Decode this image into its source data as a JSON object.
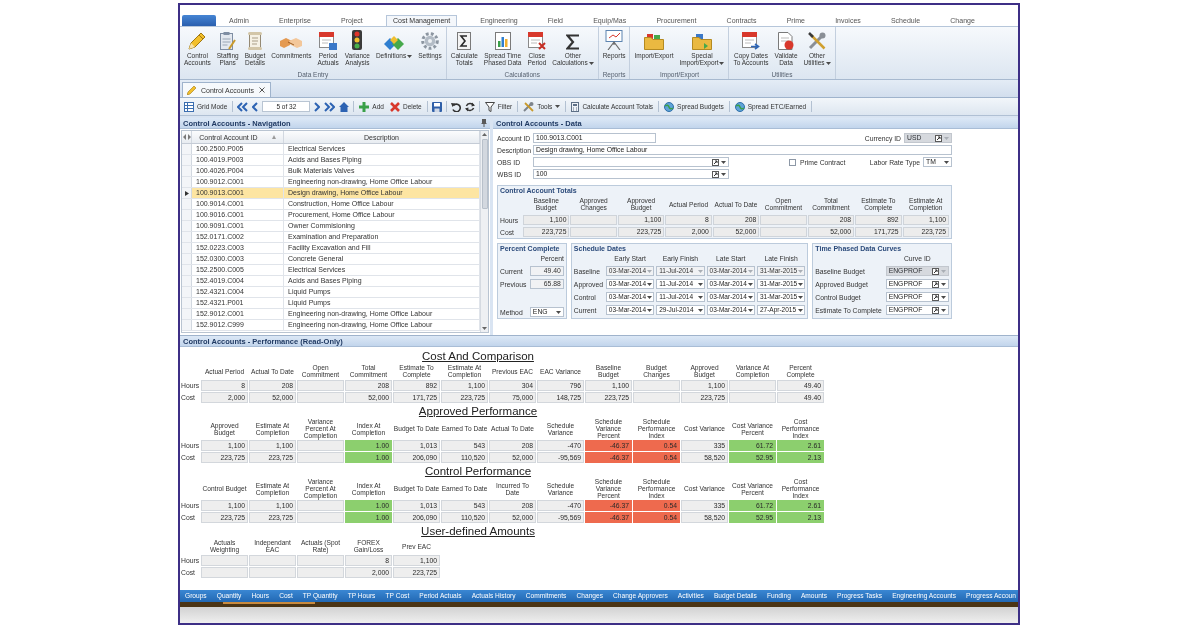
{
  "ribbon_tabs": [
    {
      "label": "Admin",
      "selected": false
    },
    {
      "label": "Enterprise",
      "selected": false
    },
    {
      "label": "Project",
      "selected": false
    },
    {
      "label": "Cost Management",
      "selected": true
    },
    {
      "label": "Engineering",
      "selected": false
    },
    {
      "label": "Field",
      "selected": false
    },
    {
      "label": "Equip/Mas",
      "selected": false
    },
    {
      "label": "Procurement",
      "selected": false
    },
    {
      "label": "Contracts",
      "selected": false
    },
    {
      "label": "Prime",
      "selected": false
    },
    {
      "label": "Invoices",
      "selected": false
    },
    {
      "label": "Schedule",
      "selected": false
    },
    {
      "label": "Change",
      "selected": false
    }
  ],
  "ribbon_groups": [
    {
      "label": "Data Entry",
      "buttons": [
        {
          "label": "Control\nAccounts",
          "dropdown": false
        },
        {
          "label": "Staffing\nPlans",
          "dropdown": false
        },
        {
          "label": "Budget\nDetails",
          "dropdown": false
        },
        {
          "label": "Commitments",
          "dropdown": false
        },
        {
          "label": "Period\nActuals",
          "dropdown": false
        },
        {
          "label": "Variance\nAnalysis",
          "dropdown": false
        },
        {
          "label": "Definitions",
          "dropdown": true
        },
        {
          "label": "Settings",
          "dropdown": false
        }
      ]
    },
    {
      "label": "Calculations",
      "buttons": [
        {
          "label": "Calculate\nTotals",
          "dropdown": false
        },
        {
          "label": "Spread Time\nPhased Data",
          "dropdown": false
        },
        {
          "label": "Close\nPeriod",
          "dropdown": false
        },
        {
          "label": "Other\nCalculations",
          "dropdown": true
        }
      ]
    },
    {
      "label": "Reports",
      "buttons": [
        {
          "label": "Reports",
          "dropdown": false
        }
      ]
    },
    {
      "label": "Import/Export",
      "buttons": [
        {
          "label": "Import/Export",
          "dropdown": false
        },
        {
          "label": "Special\nImport/Export",
          "dropdown": true
        }
      ]
    },
    {
      "label": "Utilities",
      "buttons": [
        {
          "label": "Copy Dates\nTo Accounts",
          "dropdown": false
        },
        {
          "label": "Validate\nData",
          "dropdown": false
        },
        {
          "label": "Other\nUtilities",
          "dropdown": true
        }
      ]
    }
  ],
  "document_tabs": [
    {
      "label": "Control Accounts",
      "selected": true
    }
  ],
  "toolbar": [
    {
      "kind": "button",
      "label": "Grid Mode",
      "dropdown": false
    },
    {
      "kind": "separator"
    },
    {
      "kind": "icon"
    },
    {
      "kind": "icon"
    },
    {
      "kind": "field",
      "value": "5 of 32"
    },
    {
      "kind": "icon"
    },
    {
      "kind": "icon"
    },
    {
      "kind": "icon"
    },
    {
      "kind": "separator"
    },
    {
      "kind": "button",
      "label": "Add",
      "dropdown": false
    },
    {
      "kind": "button",
      "label": "Delete",
      "dropdown": false
    },
    {
      "kind": "separator"
    },
    {
      "kind": "icon"
    },
    {
      "kind": "separator"
    },
    {
      "kind": "icon"
    },
    {
      "kind": "icon"
    },
    {
      "kind": "separator"
    },
    {
      "kind": "button",
      "label": "Filter",
      "dropdown": false
    },
    {
      "kind": "separator"
    },
    {
      "kind": "button",
      "label": "Tools",
      "dropdown": true
    },
    {
      "kind": "separator"
    },
    {
      "kind": "button",
      "label": "Calculate Account Totals",
      "dropdown": false
    },
    {
      "kind": "separator"
    },
    {
      "kind": "button",
      "label": "Spread Budgets",
      "dropdown": false
    },
    {
      "kind": "separator"
    },
    {
      "kind": "button",
      "label": "Spread ETC/Earned",
      "dropdown": false
    },
    {
      "kind": "separator"
    }
  ],
  "navigation": {
    "title": "Control Accounts - Navigation",
    "columns": [
      {
        "label": "Control Account ID",
        "sorted": true
      },
      {
        "label": "Description",
        "sorted": false
      }
    ],
    "rows": [
      {
        "id": "100.2500.P005",
        "description": "Electrical Services",
        "selected": false
      },
      {
        "id": "100.4019.P003",
        "description": "Acids and Bases Piping",
        "selected": false
      },
      {
        "id": "100.4026.P004",
        "description": "Bulk Materials Valves",
        "selected": false
      },
      {
        "id": "100.9012.C001",
        "description": "Engineering non-drawing, Home Office Labour",
        "selected": false
      },
      {
        "id": "100.9013.C001",
        "description": "Design drawing, Home Office Labour",
        "selected": true
      },
      {
        "id": "100.9014.C001",
        "description": "Construction, Home Office Labour",
        "selected": false
      },
      {
        "id": "100.9016.C001",
        "description": "Procurement, Home Office Labour",
        "selected": false
      },
      {
        "id": "100.9091.C001",
        "description": "Owner Commisioning",
        "selected": false
      },
      {
        "id": "152.0171.C002",
        "description": "Examination and Preparation",
        "selected": false
      },
      {
        "id": "152.0223.C003",
        "description": "Facility Excavation and Fill",
        "selected": false
      },
      {
        "id": "152.0300.C003",
        "description": "Concrete General",
        "selected": false
      },
      {
        "id": "152.2500.C005",
        "description": "Electrical Services",
        "selected": false
      },
      {
        "id": "152.4019.C004",
        "description": "Acids and Bases Piping",
        "selected": false
      },
      {
        "id": "152.4321.C004",
        "description": "Liquid Pumps",
        "selected": false
      },
      {
        "id": "152.4321.P001",
        "description": "Liquid Pumps",
        "selected": false
      },
      {
        "id": "152.9012.C001",
        "description": "Engineering non-drawing, Home Office Labour",
        "selected": false
      },
      {
        "id": "152.9012.C999",
        "description": "Engineering non-drawing, Home Office Labour",
        "selected": false
      }
    ]
  },
  "data_panel": {
    "title": "Control Accounts - Data",
    "account_id": {
      "label": "Account ID",
      "value": "100.9013.C001"
    },
    "currency_id": {
      "label": "Currency ID",
      "value": "USD",
      "disabled": true
    },
    "description": {
      "label": "Description",
      "value": "Design drawing, Home Office Labour"
    },
    "obs_id": {
      "label": "OBS ID"
    },
    "prime_contract": {
      "label": "Prime Contract",
      "checked": false
    },
    "labor_rate_type": {
      "label": "Labor Rate Type",
      "value": "TM"
    },
    "wbs_id": {
      "label": "WBS ID",
      "value": "100"
    },
    "totals": {
      "title": "Control Account Totals",
      "columns": [
        "Baseline\nBudget",
        "Approved\nChanges",
        "Approved\nBudget",
        "Actual Period",
        "Actual To Date",
        "Open\nCommitment",
        "Total\nCommitment",
        "Estimate To\nComplete",
        "Estimate At\nCompletion"
      ],
      "rows": [
        {
          "label": "Hours",
          "cells": [
            "1,100",
            null,
            "1,100",
            "8",
            "208",
            null,
            "208",
            "892",
            "1,100"
          ]
        },
        {
          "label": "Cost",
          "cells": [
            "223,725",
            null,
            "223,725",
            "2,000",
            "52,000",
            null,
            "52,000",
            "171,725",
            "223,725"
          ]
        }
      ]
    },
    "percent_complete": {
      "title": "Percent Complete",
      "column": "Percent",
      "rows": [
        {
          "label": "Current",
          "value": "49.40"
        },
        {
          "label": "Previous",
          "value": "65.88"
        }
      ],
      "method": {
        "label": "Method",
        "value": "ENG"
      }
    },
    "schedule_dates": {
      "title": "Schedule Dates",
      "columns": [
        "Early Start",
        "Early Finish",
        "Late Start",
        "Late Finish"
      ],
      "rows": [
        {
          "label": "Baseline",
          "disabled": true,
          "cells": [
            "03-Mar-2014",
            "11-Jul-2014",
            "03-Mar-2014",
            "31-Mar-2015"
          ]
        },
        {
          "label": "Approved",
          "disabled": false,
          "cells": [
            "03-Mar-2014",
            "11-Jul-2014",
            "03-Mar-2014",
            "31-Mar-2015"
          ]
        },
        {
          "label": "Control",
          "disabled": false,
          "cells": [
            "03-Mar-2014",
            "11-Jul-2014",
            "03-Mar-2014",
            "31-Mar-2015"
          ]
        },
        {
          "label": "Current",
          "disabled": false,
          "cells": [
            "03-Mar-2014",
            "29-Jul-2014",
            "03-Mar-2014",
            "27-Apr-2015"
          ]
        }
      ]
    },
    "curves": {
      "title": "Time Phased Data Curves",
      "column": "Curve ID",
      "rows": [
        {
          "label": "Baseline Budget",
          "value": "ENGPROF",
          "disabled": true
        },
        {
          "label": "Approved Budget",
          "value": "ENGPROF",
          "disabled": false
        },
        {
          "label": "Control Budget",
          "value": "ENGPROF",
          "disabled": false
        },
        {
          "label": "Estimate To Complete",
          "value": "ENGPROF",
          "disabled": false
        }
      ]
    }
  },
  "performance": {
    "title": "Control Accounts - Performance (Read-Only)",
    "sections": [
      {
        "title": "Cost And Comparison",
        "columns": [
          "Actual Period",
          "Actual To Date",
          "Open\nCommitment",
          "Total\nCommitment",
          "Estimate To\nComplete",
          "Estimate At\nCompletion",
          "Previous EAC",
          "EAC Variance",
          "Baseline\nBudget",
          "Budget\nChanges",
          "Approved\nBudget",
          "Variance At\nCompletion",
          "Percent\nComplete"
        ],
        "rows": [
          {
            "label": "Hours",
            "cells": [
              "8",
              "208",
              null,
              "208",
              "892",
              "1,100",
              "304",
              "796",
              "1,100",
              null,
              "1,100",
              null,
              "49.40"
            ]
          },
          {
            "label": "Cost",
            "cells": [
              "2,000",
              "52,000",
              null,
              "52,000",
              "171,725",
              "223,725",
              "75,000",
              "148,725",
              "223,725",
              null,
              "223,725",
              null,
              "49.40"
            ]
          }
        ]
      },
      {
        "title": "Approved Performance",
        "columns": [
          "Approved\nBudget",
          "Estimate At\nCompletion",
          "Variance\nPercent At\nCompletion",
          "Index At\nCompletion",
          "Budget To Date",
          "Earned To Date",
          "Actual To Date",
          "Schedule\nVariance",
          "Schedule\nVariance\nPercent",
          "Schedule\nPerformance\nIndex",
          "Cost Variance",
          "Cost Variance\nPercent",
          "Cost\nPerformance\nIndex"
        ],
        "rows": [
          {
            "label": "Hours",
            "cells": [
              "1,100",
              "1,100",
              null,
              {
                "value": "1.00",
                "color": "#8ccf6e"
              },
              "1,013",
              "543",
              "208",
              "-470",
              {
                "value": "-46.37",
                "color": "#ee6a4e"
              },
              {
                "value": "0.54",
                "color": "#ee6a4e"
              },
              "335",
              {
                "value": "61.72",
                "color": "#8ccf6e"
              },
              {
                "value": "2.61",
                "color": "#8ccf6e"
              }
            ]
          },
          {
            "label": "Cost",
            "cells": [
              "223,725",
              "223,725",
              null,
              {
                "value": "1.00",
                "color": "#8ccf6e"
              },
              "206,090",
              "110,520",
              "52,000",
              "-95,569",
              {
                "value": "-46.37",
                "color": "#ee6a4e"
              },
              {
                "value": "0.54",
                "color": "#ee6a4e"
              },
              "58,520",
              {
                "value": "52.95",
                "color": "#8ccf6e"
              },
              {
                "value": "2.13",
                "color": "#8ccf6e"
              }
            ]
          }
        ]
      },
      {
        "title": "Control Performance",
        "columns": [
          "Control Budget",
          "Estimate At\nCompletion",
          "Variance\nPercent At\nCompletion",
          "Index At\nCompletion",
          "Budget To Date",
          "Earned To Date",
          "Incurred To\nDate",
          "Schedule\nVariance",
          "Schedule\nVariance\nPercent",
          "Schedule\nPerformance\nIndex",
          "Cost Variance",
          "Cost Variance\nPercent",
          "Cost\nPerformance\nIndex"
        ],
        "rows": [
          {
            "label": "Hours",
            "cells": [
              "1,100",
              "1,100",
              null,
              {
                "value": "1.00",
                "color": "#8ccf6e"
              },
              "1,013",
              "543",
              "208",
              "-470",
              {
                "value": "-46.37",
                "color": "#ee6a4e"
              },
              {
                "value": "0.54",
                "color": "#ee6a4e"
              },
              "335",
              {
                "value": "61.72",
                "color": "#8ccf6e"
              },
              {
                "value": "2.61",
                "color": "#8ccf6e"
              }
            ]
          },
          {
            "label": "Cost",
            "cells": [
              "223,725",
              "223,725",
              null,
              {
                "value": "1.00",
                "color": "#8ccf6e"
              },
              "206,090",
              "110,520",
              "52,000",
              "-95,569",
              {
                "value": "-46.37",
                "color": "#ee6a4e"
              },
              {
                "value": "0.54",
                "color": "#ee6a4e"
              },
              "58,520",
              {
                "value": "52.95",
                "color": "#8ccf6e"
              },
              {
                "value": "2.13",
                "color": "#8ccf6e"
              }
            ]
          }
        ]
      },
      {
        "title": "User-defined Amounts",
        "columns": [
          "Actuals\nWeighting",
          "Independant\nEAC",
          "Actuals (Spot\nRate)",
          "FOREX\nGain/Loss",
          "Prev EAC"
        ],
        "rows": [
          {
            "label": "Hours",
            "cells": [
              null,
              null,
              null,
              "8",
              "1,100"
            ]
          },
          {
            "label": "Cost",
            "cells": [
              null,
              null,
              null,
              "2,000",
              "223,725"
            ]
          }
        ]
      }
    ]
  },
  "bottom_tabs": [
    "Groups",
    "Quantity",
    "Hours",
    "Cost",
    "TP Quantity",
    "TP Hours",
    "TP Cost",
    "Period Actuals",
    "Actuals History",
    "Commitments",
    "Changes",
    "Change Approvers",
    "Activities",
    "Budget Details",
    "Funding",
    "Amounts",
    "Progress Tasks",
    "Engineering Accounts",
    "Progress Accoun"
  ]
}
